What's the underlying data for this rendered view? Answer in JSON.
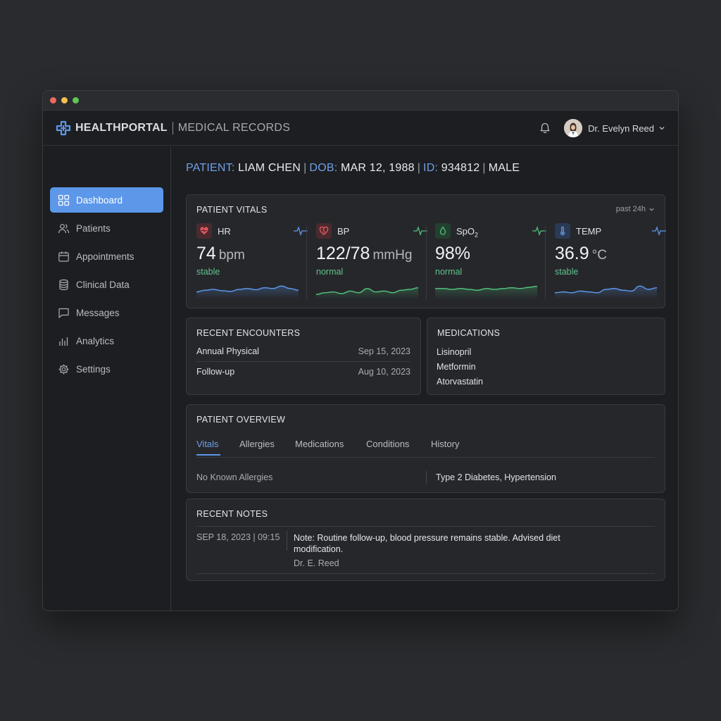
{
  "window": {
    "traffic_lights": [
      "#ed6a5e",
      "#f4bf4f",
      "#61c554"
    ]
  },
  "header": {
    "brand": "HEALTHPORTAL",
    "subtitle": "MEDICAL RECORDS",
    "user_name": "Dr. Evelyn Reed",
    "accent": "#5c97ea"
  },
  "sidebar": {
    "items": [
      {
        "label": "Dashboard",
        "icon": "grid-icon",
        "active": true
      },
      {
        "label": "Patients",
        "icon": "users-icon"
      },
      {
        "label": "Appointments",
        "icon": "calendar-icon"
      },
      {
        "label": "Clinical Data",
        "icon": "database-icon"
      },
      {
        "label": "Messages",
        "icon": "chat-icon"
      },
      {
        "label": "Analytics",
        "icon": "bar-chart-icon"
      },
      {
        "label": "Settings",
        "icon": "gear-icon"
      }
    ]
  },
  "patient": {
    "k_patient": "PATIENT:",
    "name": "LIAM CHEN",
    "k_dob": "DOB:",
    "dob": "MAR 12, 1988",
    "k_id": "ID:",
    "id": "934812",
    "sex": "MALE"
  },
  "vitals": {
    "title": "PATIENT VITALS",
    "range": "past 24h",
    "items": [
      {
        "label": "HR",
        "value": "74",
        "unit": "bpm",
        "status": "stable",
        "color": "#5c97ea",
        "icon": "heart-icon",
        "trend": [
          0.35,
          0.45,
          0.5,
          0.42,
          0.38,
          0.5,
          0.55,
          0.48,
          0.6,
          0.55,
          0.7,
          0.55,
          0.45
        ]
      },
      {
        "label": "BP",
        "value": "122/78",
        "unit": "mmHg",
        "status": "normal",
        "color": "#4fbf7a",
        "icon": "heart-broken-icon",
        "trend": [
          0.2,
          0.3,
          0.35,
          0.25,
          0.4,
          0.3,
          0.55,
          0.35,
          0.4,
          0.3,
          0.45,
          0.5,
          0.6
        ]
      },
      {
        "label": "SpO",
        "label_sub": "2",
        "value": "98%",
        "unit": "",
        "status": "normal",
        "color": "#4fbf7a",
        "icon": "droplet-icon",
        "trend": [
          0.55,
          0.55,
          0.5,
          0.55,
          0.5,
          0.45,
          0.55,
          0.5,
          0.55,
          0.6,
          0.55,
          0.62,
          0.68
        ]
      },
      {
        "label": "TEMP",
        "value": "36.9",
        "unit": "°C",
        "status": "stable",
        "color": "#5c97ea",
        "icon": "thermometer-icon",
        "trend": [
          0.3,
          0.35,
          0.3,
          0.4,
          0.35,
          0.3,
          0.5,
          0.55,
          0.45,
          0.4,
          0.7,
          0.5,
          0.6
        ]
      }
    ]
  },
  "encounters": {
    "title": "RECENT ENCOUNTERS",
    "rows": [
      {
        "name": "Annual Physical",
        "date": "Sep 15, 2023"
      },
      {
        "name": "Follow-up",
        "date": "Aug 10, 2023"
      }
    ]
  },
  "medications": {
    "title": "MEDICATIONS",
    "items": [
      "Lisinopril",
      "Metformin",
      "Atorvastatin"
    ]
  },
  "overview": {
    "title": "PATIENT OVERVIEW",
    "tabs": [
      "Vitals",
      "Allergies",
      "Medications",
      "Conditions",
      "History"
    ],
    "allergies": "No Known Allergies",
    "conditions": "Type 2 Diabetes, Hypertension"
  },
  "notes": {
    "title": "RECENT NOTES",
    "date": "SEP 18, 2023 | 09:15",
    "text": "Note: Routine follow-up, blood pressure remains stable. Advised diet modification.",
    "author": "Dr. E. Reed"
  }
}
